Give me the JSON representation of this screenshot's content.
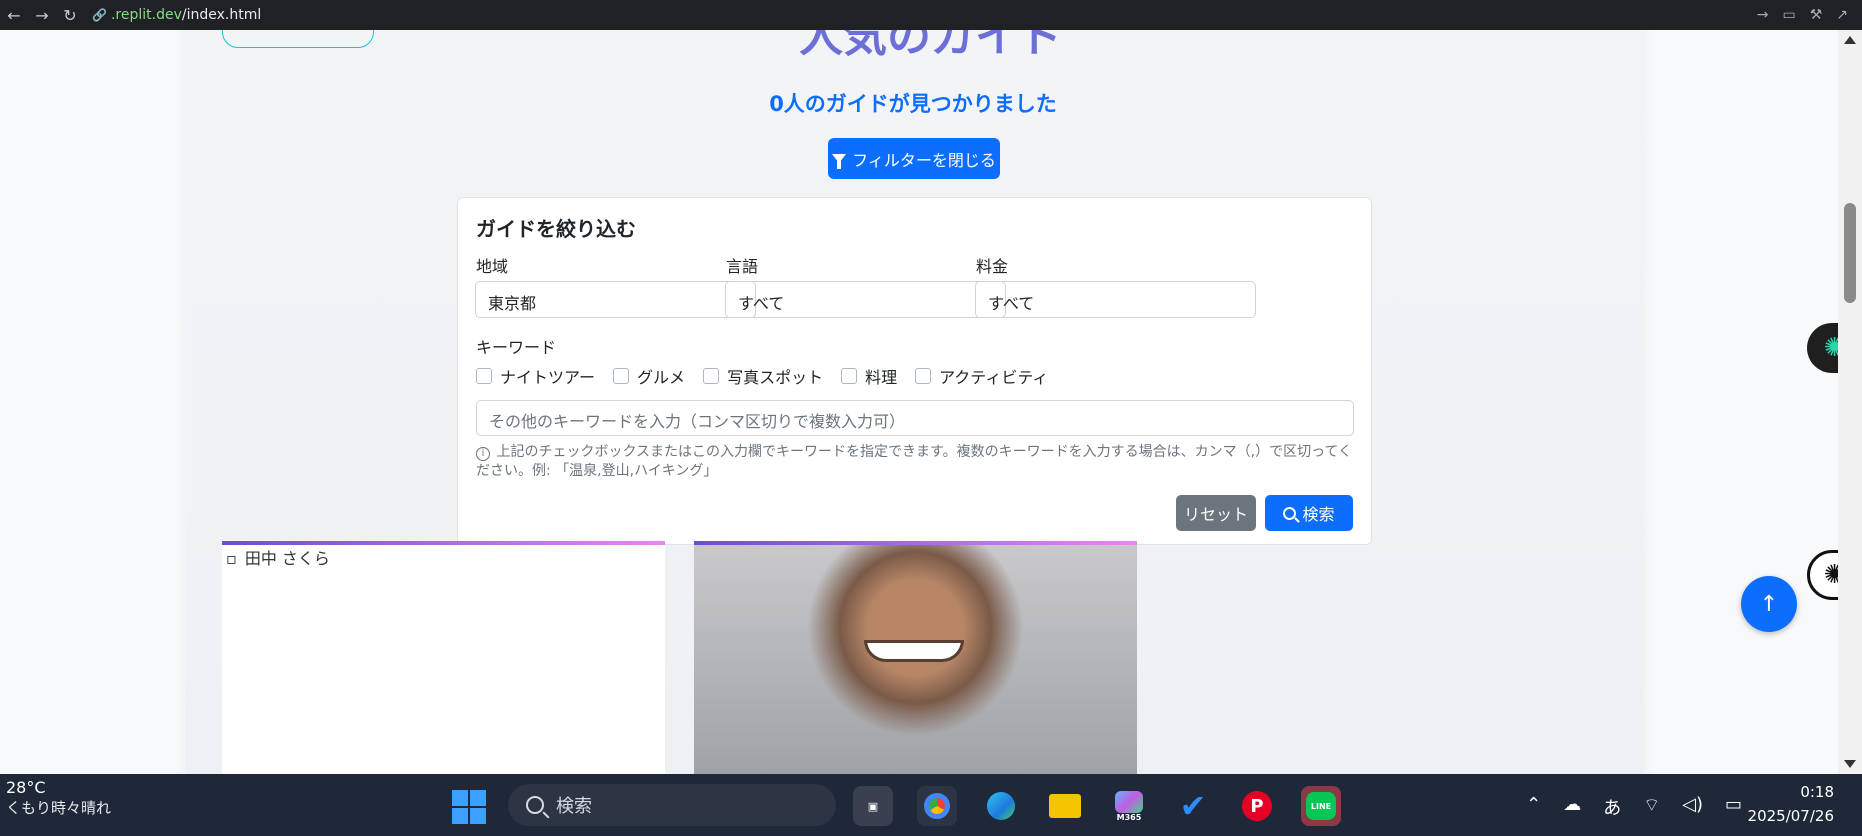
{
  "browser": {
    "url_domain": ".replit.dev",
    "url_path": "/index.html"
  },
  "page": {
    "heading": "人気のガイド",
    "result_count": "0人のガイドが見つかりました",
    "toggle_filter_label": "フィルターを閉じる"
  },
  "filter": {
    "title": "ガイドを絞り込む",
    "region_label": "地域",
    "region_value": "東京都",
    "language_label": "言語",
    "language_value": "すべて",
    "price_label": "料金",
    "price_value": "すべて",
    "keyword_label": "キーワード",
    "keywords": [
      "ナイトツアー",
      "グルメ",
      "写真スポット",
      "料理",
      "アクティビティ"
    ],
    "keyword_placeholder": "その他のキーワードを入力（コンマ区切りで複数入力可）",
    "help_text": "上記のチェックボックスまたはこの入力欄でキーワードを指定できます。複数のキーワードを入力する場合は、カンマ（,）で区切ってください。例: 「温泉,登山,ハイキング」",
    "reset_label": "リセット",
    "search_label": "検索"
  },
  "guides": [
    {
      "img_alt": "田中 さくら"
    }
  ],
  "taskbar": {
    "temperature": "28°C",
    "weather": "くもり時々晴れ",
    "search_placeholder": "検索",
    "ime": "あ",
    "time": "0:18",
    "date": "2025/07/26",
    "m365_label": "M365",
    "line_label": "LINE"
  },
  "colors": {
    "primary": "#0d6efd",
    "secondary": "#6c757d",
    "heading": "#6c6fd6",
    "taskbar": "#1f2838"
  }
}
